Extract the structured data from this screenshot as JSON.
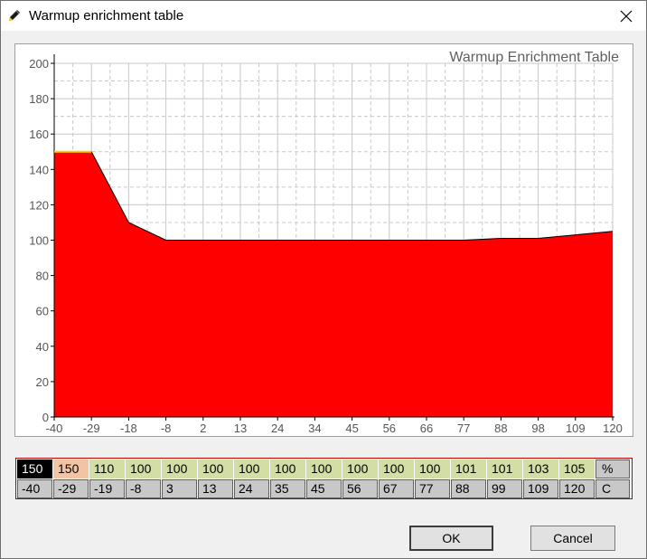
{
  "window": {
    "title": "Warmup enrichment table",
    "icon": "pencil-icon",
    "close_icon": "close-icon"
  },
  "chart_data": {
    "type": "area",
    "title": "Warmup Enrichment Table",
    "xlabel": "",
    "ylabel": "",
    "x_tick_labels": [
      "-40",
      "-29",
      "-18",
      "-8",
      "2",
      "13",
      "24",
      "34",
      "45",
      "56",
      "66",
      "77",
      "88",
      "98",
      "109",
      "120"
    ],
    "y_ticks": [
      0,
      20,
      40,
      60,
      80,
      100,
      120,
      140,
      160,
      180,
      200
    ],
    "ylim": [
      0,
      200
    ],
    "x": [
      -40,
      -29,
      -19,
      -8,
      3,
      13,
      24,
      35,
      45,
      56,
      67,
      77,
      88,
      99,
      109,
      120
    ],
    "values": [
      150,
      150,
      110,
      100,
      100,
      100,
      100,
      100,
      100,
      100,
      100,
      100,
      101,
      101,
      103,
      105
    ],
    "fill_color": "#ff0000",
    "grid": true
  },
  "table": {
    "values": [
      "150",
      "150",
      "110",
      "100",
      "100",
      "100",
      "100",
      "100",
      "100",
      "100",
      "100",
      "100",
      "101",
      "101",
      "103",
      "105"
    ],
    "temps": [
      "-40",
      "-29",
      "-19",
      "-8",
      "3",
      "13",
      "24",
      "35",
      "45",
      "56",
      "67",
      "77",
      "88",
      "99",
      "109",
      "120"
    ],
    "value_unit": "%",
    "temp_unit": "C",
    "selected_index": 0
  },
  "buttons": {
    "ok": "OK",
    "cancel": "Cancel"
  }
}
